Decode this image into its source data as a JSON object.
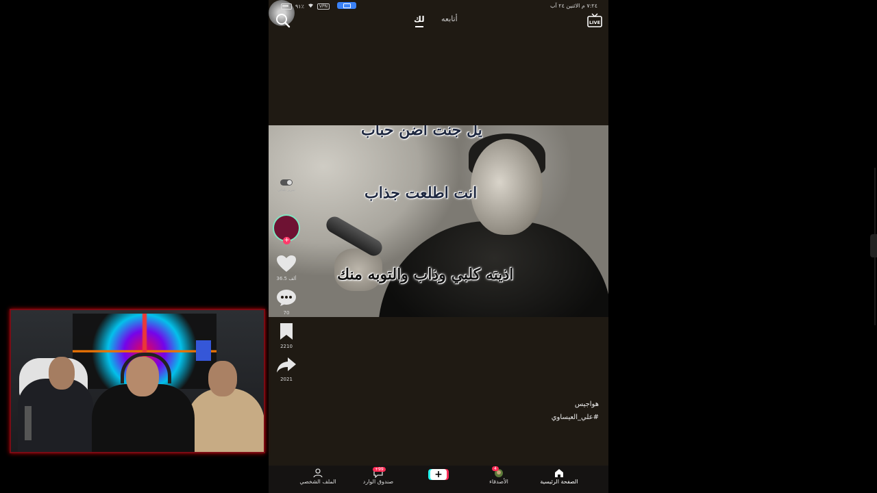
{
  "status_bar": {
    "time_date": "٧:٢٤ م  الاثنين ٢٤ آب",
    "battery_text": "٩١٪",
    "vpn": "VPN"
  },
  "top_nav": {
    "tab_following": "أتابعه",
    "tab_foryou": "لك",
    "live_label": "LIVE",
    "search_icon": "search-icon"
  },
  "video": {
    "lyrics": [
      "يل جنت اضن حباب",
      "انت اطلعت جذاب",
      "اذيته كلبي وذاب والتوبه منك"
    ]
  },
  "actions": {
    "autoscroll_label": "تمرير تلقائي",
    "likes": "36.5 ألف",
    "comments": "70",
    "saves": "2210",
    "shares": "2021"
  },
  "caption": {
    "username": "هواجيس",
    "hashtag": "#علي_العيساوي"
  },
  "bottom_nav": {
    "home": "الصفحة الرئيسية",
    "friends": "الأصدقاء",
    "create": "+",
    "inbox": "صندوق الوارد",
    "profile": "الملف الشخصي",
    "inbox_badge": "+99",
    "friends_badge": "4"
  },
  "colors": {
    "phone_bg": "#1f1a13",
    "accent_red": "#fe2c55",
    "accent_cyan": "#25f4ee",
    "webcam_border": "#7a0b14"
  }
}
